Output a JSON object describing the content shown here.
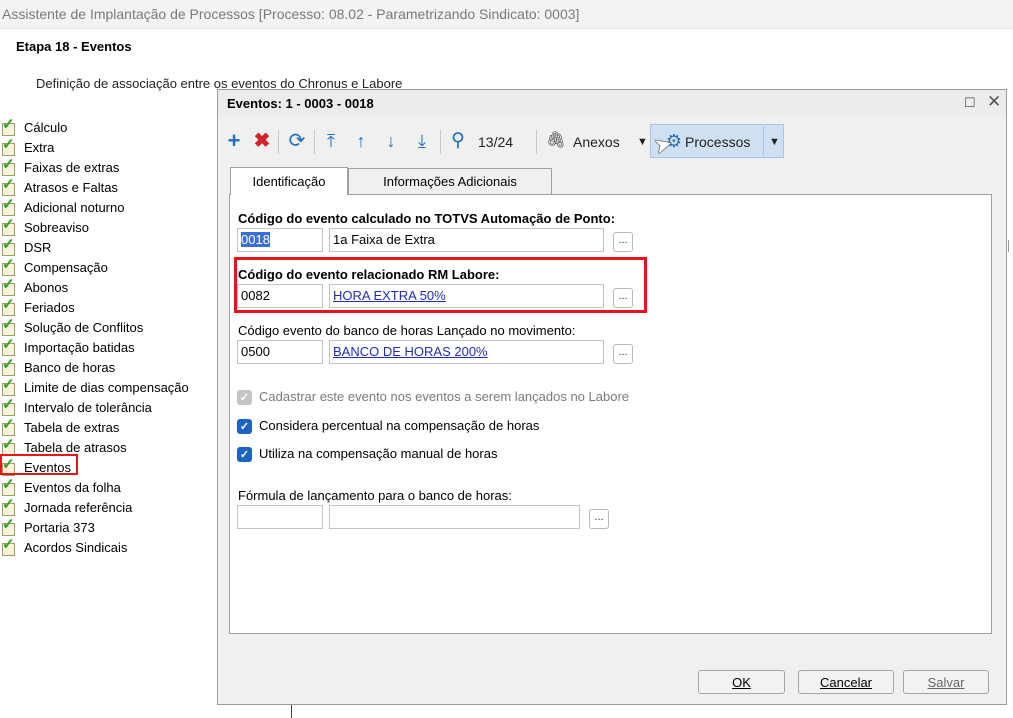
{
  "window": {
    "title": "Assistente de Implantação de Processos [Processo: 08.02 - Parametrizando Sindicato: 0003]",
    "step_title": "Etapa 18 - Eventos",
    "step_description": "Definição de associação entre os eventos do Chronus e Labore"
  },
  "sidebar": {
    "items": [
      {
        "label": "Cálculo"
      },
      {
        "label": "Extra"
      },
      {
        "label": "Faixas de extras"
      },
      {
        "label": "Atrasos e Faltas"
      },
      {
        "label": "Adicional noturno"
      },
      {
        "label": "Sobreaviso"
      },
      {
        "label": "DSR"
      },
      {
        "label": "Compensação"
      },
      {
        "label": "Abonos"
      },
      {
        "label": "Feriados"
      },
      {
        "label": "Solução de Conflitos"
      },
      {
        "label": "Importação batidas"
      },
      {
        "label": "Banco de horas"
      },
      {
        "label": "Limite de dias compensação"
      },
      {
        "label": "Intervalo de tolerância"
      },
      {
        "label": "Tabela de extras"
      },
      {
        "label": "Tabela de atrasos"
      },
      {
        "label": "Eventos",
        "selected": true
      },
      {
        "label": "Eventos da folha"
      },
      {
        "label": "Jornada referência"
      },
      {
        "label": "Portaria 373"
      },
      {
        "label": "Acordos Sindicais"
      }
    ],
    "item_icon": "green-check-document-icon"
  },
  "dialog": {
    "title": "Eventos: 1 - 0003 - 0018",
    "toolbar": {
      "add_icon": "plus-icon",
      "delete_icon": "x-icon",
      "refresh_icon": "refresh-icon",
      "record_position": "13/24",
      "anexos_label": "Anexos",
      "processos_label": "Processos"
    },
    "tabs": [
      {
        "label": "Identificação",
        "active": true
      },
      {
        "label": "Informações Adicionais",
        "active": false
      }
    ],
    "fields": {
      "calc_event": {
        "label": "Código do evento calculado no TOTVS Automação de Ponto:",
        "code": "0018",
        "description": "1a Faixa de Extra"
      },
      "labore_event": {
        "label": "Código do evento relacionado RM Labore:",
        "code": "0082",
        "description": "HORA EXTRA 50%"
      },
      "bank_event": {
        "label": "Código evento do banco de horas Lançado no movimento:",
        "code": "0500",
        "description": "BANCO DE HORAS 200%"
      },
      "formula": {
        "label": "Fórmula de lançamento para o banco de horas:",
        "code": "",
        "description": ""
      },
      "ellipsis_label": "..."
    },
    "checkboxes": [
      {
        "label": "Cadastrar este evento nos eventos a serem lançados no Labore",
        "checked": true,
        "disabled": true
      },
      {
        "label": "Considera percentual na compensação de horas",
        "checked": true,
        "disabled": false
      },
      {
        "label": "Utiliza na compensação manual de horas",
        "checked": true,
        "disabled": false
      }
    ],
    "buttons": {
      "ok": "OK",
      "cancel": "Cancelar",
      "save": "Salvar"
    }
  },
  "colors": {
    "highlight_red": "#e3161b",
    "accent_blue": "#1c64c4",
    "link_blue": "#1f2ebd"
  }
}
